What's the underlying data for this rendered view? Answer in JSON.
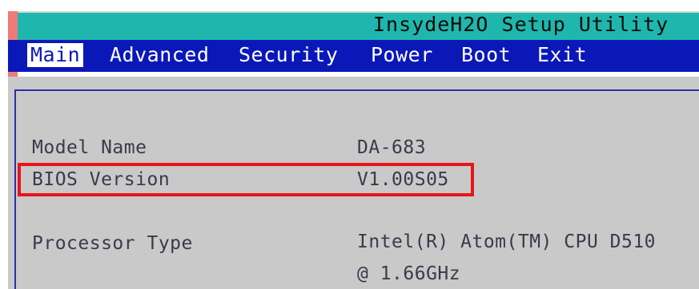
{
  "title": "InsydeH2O Setup Utility",
  "menu": {
    "items": [
      {
        "label": "Main",
        "active": true
      },
      {
        "label": "Advanced",
        "active": false
      },
      {
        "label": "Security",
        "active": false
      },
      {
        "label": "Power",
        "active": false
      },
      {
        "label": "Boot",
        "active": false
      },
      {
        "label": "Exit",
        "active": false
      }
    ]
  },
  "main": {
    "rows": [
      {
        "label": "Model Name",
        "value": "DA-683"
      },
      {
        "label": "BIOS Version",
        "value": "V1.00S05",
        "highlighted": true
      },
      {
        "label": "Processor Type",
        "value": "Intel(R) Atom(TM) CPU D510",
        "value_line2": "@ 1.66GHz"
      }
    ]
  },
  "colors": {
    "title_bar": "#1fb7ad",
    "menu_bar": "#0b18b8",
    "content_bg": "#c9c9c9",
    "highlight_border": "#e8141a",
    "accent": "#ef7a7a"
  }
}
